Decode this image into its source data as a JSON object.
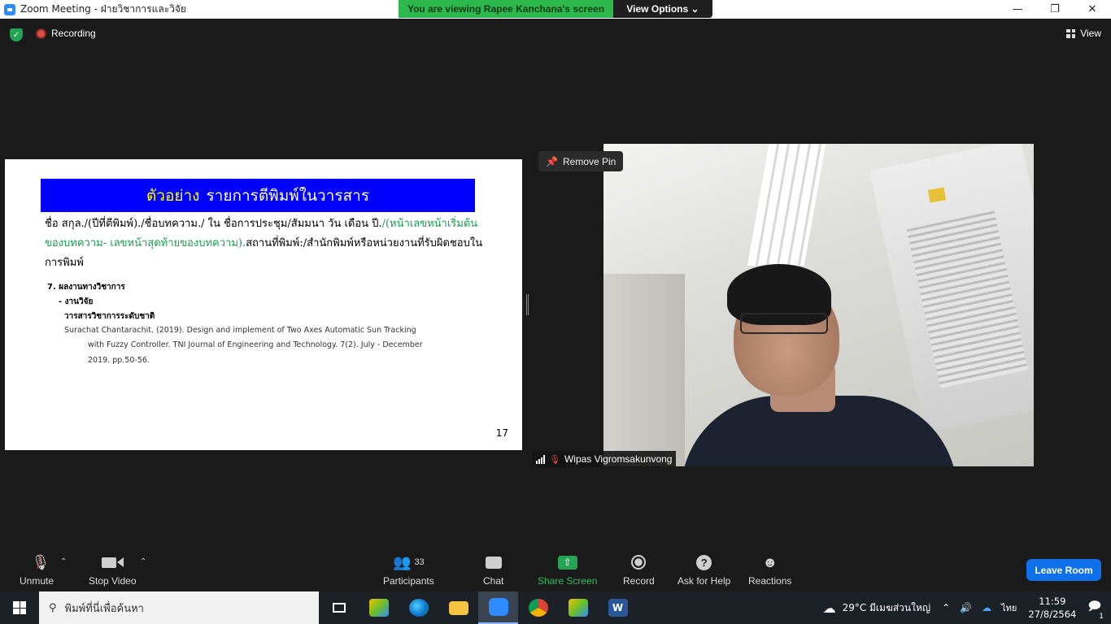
{
  "window": {
    "title": "Zoom Meeting - ฝ่ายวิชาการและวิจัย"
  },
  "banner": {
    "message": "You are viewing Rapee Kanchana's screen",
    "view_options": "View Options"
  },
  "status": {
    "recording": "Recording",
    "view": "View"
  },
  "slide": {
    "header_highlight": "ตัวอย่าง",
    "header_rest": "รายการตีพิมพ์ในวารสาร",
    "ref_black_1": "ชื่อ สกุล./(ปีที่ตีพิมพ์)./ชื่อบทความ./ ใน  ชื่อการประชุม/สัมมนา วัน เดือน ปี.",
    "ref_green": "/(หน้าเลขหน้าเริ่มต้นของบทความ- เลขหน้าสุดท้ายของบทความ).",
    "ref_black_2": "สถานที่พิมพ์:/สำนักพิมพ์หรือหน่วยงานที่รับผิดชอบในการพิมพ์",
    "item7": "7. ผลงานทางวิชาการ",
    "sub1": "- งานวิจัย",
    "sub2": "วารสารวิชาการระดับชาติ",
    "cite_line1": "Surachat Chantarachit. (2019).  Design and implement of Two Axes Automatic Sun Tracking",
    "cite_line2": "with Fuzzy Controller. TNI Journal of Engineering and Technology. 7(2). July - December",
    "cite_line3": "2019. pp.50-56.",
    "page_number": "17"
  },
  "video": {
    "remove_pin": "Remove Pin",
    "participant_name": "Wipas Vigromsakunvong"
  },
  "toolbar": {
    "unmute": "Unmute",
    "stop_video": "Stop Video",
    "participants": "Participants",
    "participants_count": "33",
    "chat": "Chat",
    "share_screen": "Share Screen",
    "record": "Record",
    "ask_for_help": "Ask for Help",
    "reactions": "Reactions",
    "leave_room": "Leave Room"
  },
  "taskbar": {
    "search_placeholder": "พิมพ์ที่นี่เพื่อค้นหา",
    "weather": "29°C  มีเมฆส่วนใหญ่",
    "language": "ไทย",
    "time": "11:59",
    "date": "27/8/2564",
    "notifications": "1"
  },
  "colors": {
    "accent_blue": "#0e71eb",
    "share_green": "#23a455",
    "slide_header_blue": "#0000ff"
  }
}
